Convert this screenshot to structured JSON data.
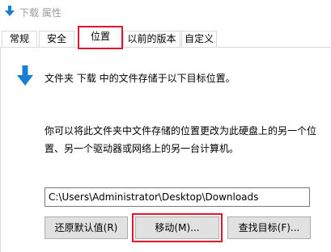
{
  "window": {
    "title": "下载 属性"
  },
  "tabs": [
    {
      "label": "常规"
    },
    {
      "label": "安全"
    },
    {
      "label": "位置"
    },
    {
      "label": "以前的版本"
    },
    {
      "label": "自定义"
    }
  ],
  "location": {
    "description": "文件夹 下载 中的文件存储于以下目标位置。",
    "paragraph": "你可以将此文件夹中文件存储的位置更改为此硬盘上的另一个位置、另一个驱动器或网络上的另一台计算机。",
    "path": "C:\\Users\\Administrator\\Desktop\\Downloads"
  },
  "buttons": {
    "restore_default": "还原默认值(R)",
    "move": "移动(M)...",
    "find_target": "查找目标(F)..."
  },
  "colors": {
    "accent_arrow": "#1a7fd4",
    "highlight_box": "#e0142a"
  }
}
